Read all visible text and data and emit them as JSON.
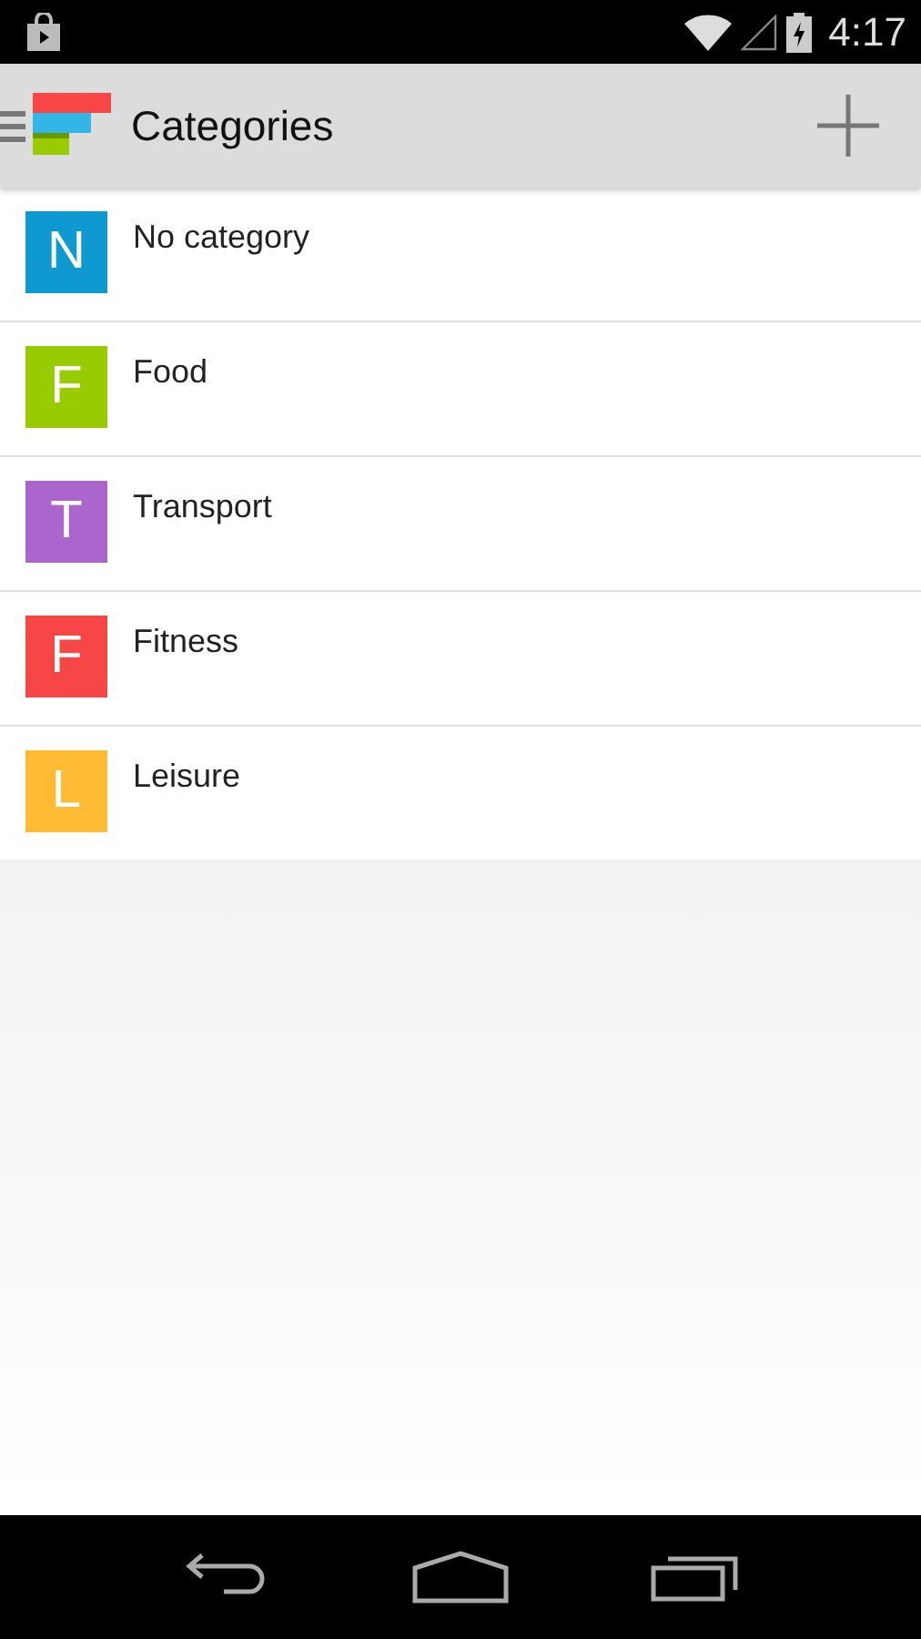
{
  "status_bar": {
    "time": "4:17"
  },
  "app_bar": {
    "title": "Categories"
  },
  "categories": [
    {
      "letter": "N",
      "name": "No category",
      "color": "#0e99d0"
    },
    {
      "letter": "F",
      "name": "Food",
      "color": "#98cc00"
    },
    {
      "letter": "T",
      "name": "Transport",
      "color": "#aa66cc"
    },
    {
      "letter": "F",
      "name": "Fitness",
      "color": "#f64646"
    },
    {
      "letter": "L",
      "name": "Leisure",
      "color": "#ffbb33"
    }
  ]
}
